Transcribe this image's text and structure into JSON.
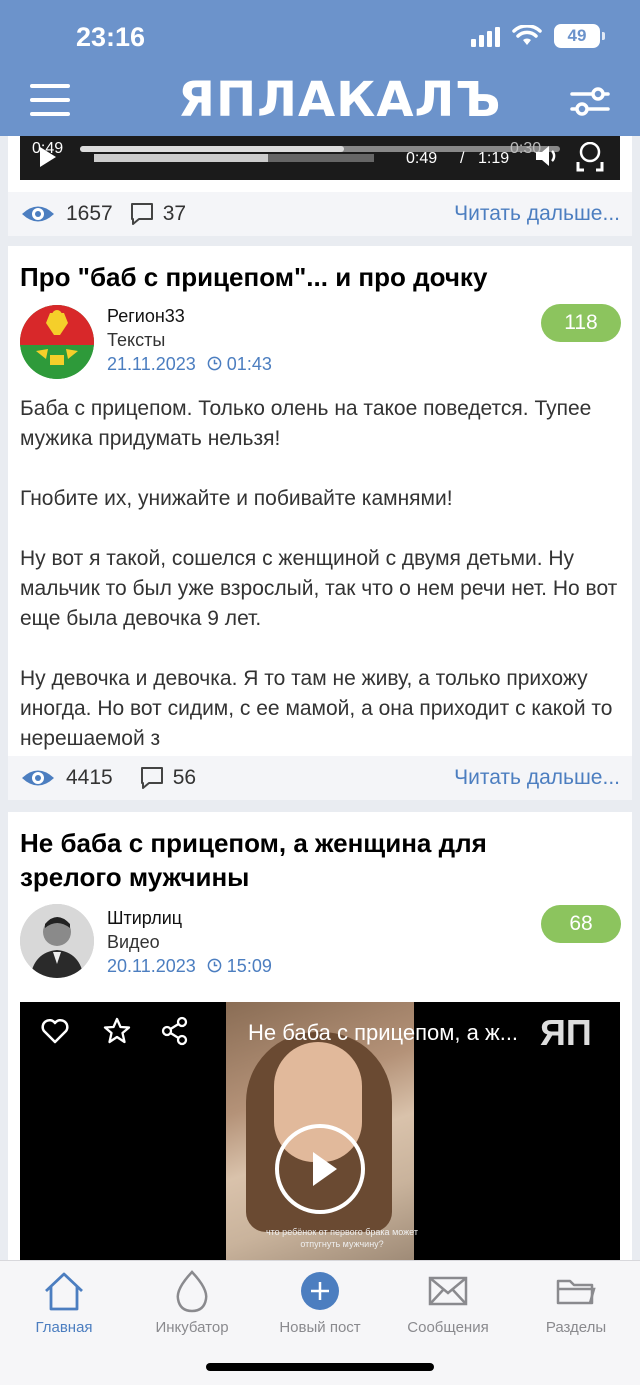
{
  "status": {
    "time": "23:16",
    "battery": "49"
  },
  "header": {
    "logo": "ЯПЛАКАЛЪ"
  },
  "top_player": {
    "left_time": "0:49",
    "current": "0:49",
    "separator": "/",
    "duration": "1:19",
    "right_time": "0:30"
  },
  "top_card_footer": {
    "views": "1657",
    "comments": "37",
    "read_more": "Читать дальше..."
  },
  "post1": {
    "title": "Про \"баб с прицепом\"... и про дочку",
    "author": "Регион33",
    "section": "Тексты",
    "date": "21.11.2023",
    "time": "01:43",
    "rating": "118",
    "paragraphs": [
      "Баба с прицепом. Только олень на такое поведется. Тупее мужика придумать нельзя!",
      "Гнобите их, унижайте и побивайте камнями!",
      "Ну вот я такой, сошелся с женщиной с двумя детьми. Ну мальчик то был уже взрослый, так что о нем речи нет. Но вот еще была девочка 9 лет.",
      "Ну девочка и девочка. Я то там не живу, а только прихожу иногда. Но вот сидим, с ее мамой, а она приходит с какой то нерешаемой з"
    ],
    "views": "4415",
    "comments": "56",
    "read_more": "Читать дальше..."
  },
  "post2": {
    "title": "Не баба с прицепом, а женщина для зрелого мужчины",
    "author": "Штирлиц",
    "section": "Видео",
    "date": "20.11.2023",
    "time": "15:09",
    "rating": "68",
    "video_title": "Не баба с прицепом, а ж...",
    "video_subtitle": "что ребёнок от первого брака может отпугнуть мужчину?",
    "video_logo": "ЯП"
  },
  "tabs": [
    {
      "label": "Главная",
      "icon": "home-icon"
    },
    {
      "label": "Инкубатор",
      "icon": "egg-icon"
    },
    {
      "label": "Новый пост",
      "icon": "plus-circle-icon"
    },
    {
      "label": "Сообщения",
      "icon": "envelope-icon"
    },
    {
      "label": "Разделы",
      "icon": "folder-icon"
    }
  ],
  "colors": {
    "header": "#6c93cb",
    "accent": "#4c7ec0",
    "rating": "#8cc45e"
  }
}
